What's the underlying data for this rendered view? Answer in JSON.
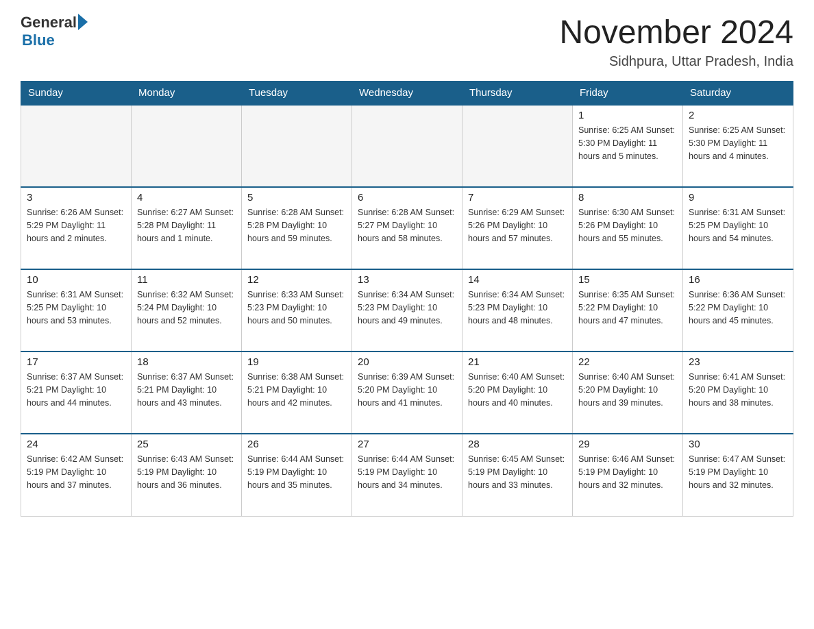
{
  "header": {
    "logo_general": "General",
    "logo_blue": "Blue",
    "month_title": "November 2024",
    "location": "Sidhpura, Uttar Pradesh, India"
  },
  "weekdays": [
    "Sunday",
    "Monday",
    "Tuesday",
    "Wednesday",
    "Thursday",
    "Friday",
    "Saturday"
  ],
  "rows": [
    [
      {
        "day": "",
        "info": ""
      },
      {
        "day": "",
        "info": ""
      },
      {
        "day": "",
        "info": ""
      },
      {
        "day": "",
        "info": ""
      },
      {
        "day": "",
        "info": ""
      },
      {
        "day": "1",
        "info": "Sunrise: 6:25 AM\nSunset: 5:30 PM\nDaylight: 11 hours and 5 minutes."
      },
      {
        "day": "2",
        "info": "Sunrise: 6:25 AM\nSunset: 5:30 PM\nDaylight: 11 hours and 4 minutes."
      }
    ],
    [
      {
        "day": "3",
        "info": "Sunrise: 6:26 AM\nSunset: 5:29 PM\nDaylight: 11 hours and 2 minutes."
      },
      {
        "day": "4",
        "info": "Sunrise: 6:27 AM\nSunset: 5:28 PM\nDaylight: 11 hours and 1 minute."
      },
      {
        "day": "5",
        "info": "Sunrise: 6:28 AM\nSunset: 5:28 PM\nDaylight: 10 hours and 59 minutes."
      },
      {
        "day": "6",
        "info": "Sunrise: 6:28 AM\nSunset: 5:27 PM\nDaylight: 10 hours and 58 minutes."
      },
      {
        "day": "7",
        "info": "Sunrise: 6:29 AM\nSunset: 5:26 PM\nDaylight: 10 hours and 57 minutes."
      },
      {
        "day": "8",
        "info": "Sunrise: 6:30 AM\nSunset: 5:26 PM\nDaylight: 10 hours and 55 minutes."
      },
      {
        "day": "9",
        "info": "Sunrise: 6:31 AM\nSunset: 5:25 PM\nDaylight: 10 hours and 54 minutes."
      }
    ],
    [
      {
        "day": "10",
        "info": "Sunrise: 6:31 AM\nSunset: 5:25 PM\nDaylight: 10 hours and 53 minutes."
      },
      {
        "day": "11",
        "info": "Sunrise: 6:32 AM\nSunset: 5:24 PM\nDaylight: 10 hours and 52 minutes."
      },
      {
        "day": "12",
        "info": "Sunrise: 6:33 AM\nSunset: 5:23 PM\nDaylight: 10 hours and 50 minutes."
      },
      {
        "day": "13",
        "info": "Sunrise: 6:34 AM\nSunset: 5:23 PM\nDaylight: 10 hours and 49 minutes."
      },
      {
        "day": "14",
        "info": "Sunrise: 6:34 AM\nSunset: 5:23 PM\nDaylight: 10 hours and 48 minutes."
      },
      {
        "day": "15",
        "info": "Sunrise: 6:35 AM\nSunset: 5:22 PM\nDaylight: 10 hours and 47 minutes."
      },
      {
        "day": "16",
        "info": "Sunrise: 6:36 AM\nSunset: 5:22 PM\nDaylight: 10 hours and 45 minutes."
      }
    ],
    [
      {
        "day": "17",
        "info": "Sunrise: 6:37 AM\nSunset: 5:21 PM\nDaylight: 10 hours and 44 minutes."
      },
      {
        "day": "18",
        "info": "Sunrise: 6:37 AM\nSunset: 5:21 PM\nDaylight: 10 hours and 43 minutes."
      },
      {
        "day": "19",
        "info": "Sunrise: 6:38 AM\nSunset: 5:21 PM\nDaylight: 10 hours and 42 minutes."
      },
      {
        "day": "20",
        "info": "Sunrise: 6:39 AM\nSunset: 5:20 PM\nDaylight: 10 hours and 41 minutes."
      },
      {
        "day": "21",
        "info": "Sunrise: 6:40 AM\nSunset: 5:20 PM\nDaylight: 10 hours and 40 minutes."
      },
      {
        "day": "22",
        "info": "Sunrise: 6:40 AM\nSunset: 5:20 PM\nDaylight: 10 hours and 39 minutes."
      },
      {
        "day": "23",
        "info": "Sunrise: 6:41 AM\nSunset: 5:20 PM\nDaylight: 10 hours and 38 minutes."
      }
    ],
    [
      {
        "day": "24",
        "info": "Sunrise: 6:42 AM\nSunset: 5:19 PM\nDaylight: 10 hours and 37 minutes."
      },
      {
        "day": "25",
        "info": "Sunrise: 6:43 AM\nSunset: 5:19 PM\nDaylight: 10 hours and 36 minutes."
      },
      {
        "day": "26",
        "info": "Sunrise: 6:44 AM\nSunset: 5:19 PM\nDaylight: 10 hours and 35 minutes."
      },
      {
        "day": "27",
        "info": "Sunrise: 6:44 AM\nSunset: 5:19 PM\nDaylight: 10 hours and 34 minutes."
      },
      {
        "day": "28",
        "info": "Sunrise: 6:45 AM\nSunset: 5:19 PM\nDaylight: 10 hours and 33 minutes."
      },
      {
        "day": "29",
        "info": "Sunrise: 6:46 AM\nSunset: 5:19 PM\nDaylight: 10 hours and 32 minutes."
      },
      {
        "day": "30",
        "info": "Sunrise: 6:47 AM\nSunset: 5:19 PM\nDaylight: 10 hours and 32 minutes."
      }
    ]
  ]
}
